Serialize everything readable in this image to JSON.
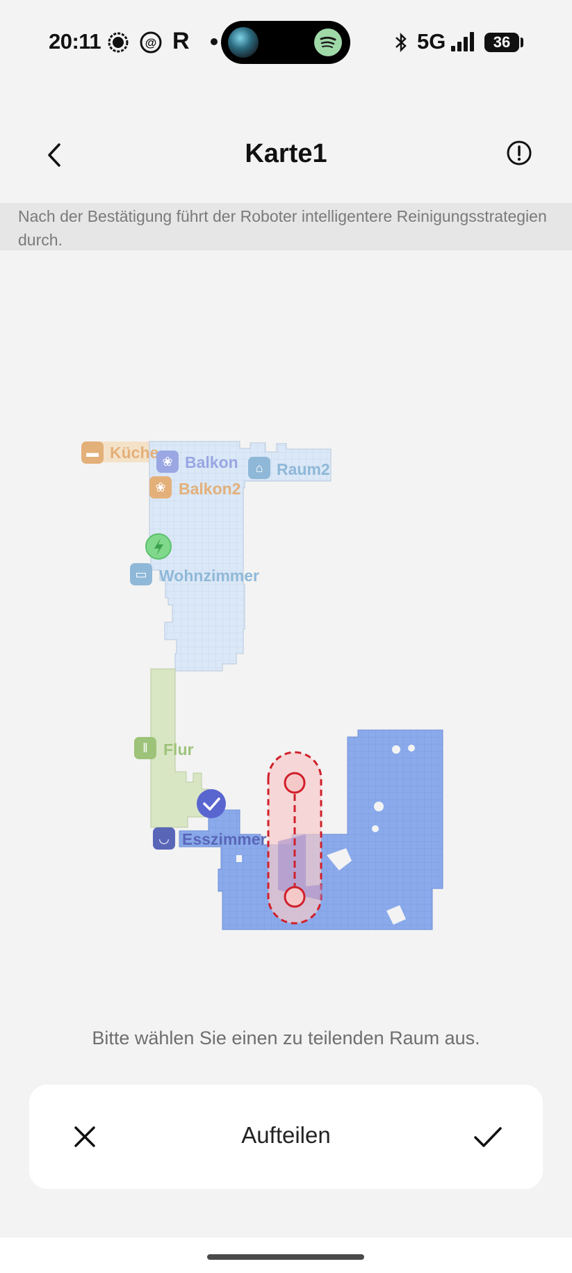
{
  "status_bar": {
    "time": "20:11",
    "network": "5G",
    "battery": "36",
    "icons": [
      "signal-messenger-icon",
      "at-icon",
      "r-app-icon",
      "dot-icon",
      "bluetooth-icon",
      "cell-signal-icon",
      "spotify-icon"
    ]
  },
  "header": {
    "title": "Karte1",
    "back_icon": "chevron-left-icon",
    "info_icon": "info-circle-icon"
  },
  "banner": {
    "text": "Nach der Bestätigung führt der Roboter intelligentere Reinigungsstrategien durch."
  },
  "map": {
    "rooms": [
      {
        "name": "Küche",
        "icon": "pot-icon",
        "color": "#e3b07a"
      },
      {
        "name": "Balkon",
        "icon": "plant-icon",
        "color": "#9aa7e3"
      },
      {
        "name": "Raum2",
        "icon": "house-icon",
        "color": "#8fb8d8"
      },
      {
        "name": "Balkon2",
        "icon": "plant-icon",
        "color": "#e3b07a"
      },
      {
        "name": "Wohnzimmer",
        "icon": "sofa-icon",
        "color": "#8fb8d8"
      },
      {
        "name": "Flur",
        "icon": "door-icon",
        "color": "#9dc37a"
      },
      {
        "name": "Esszimmer",
        "icon": "bowl-icon",
        "color": "#5966b8"
      }
    ],
    "dock_icon": "charging-dock-icon",
    "selected_icon": "check-badge-icon",
    "colors": {
      "upper_area": "#dbe8f7",
      "hall_area": "#d9e6c4",
      "selected_room": "#8aaaeb",
      "split_line": "#d0202a",
      "split_fill": "#f6c9c9"
    }
  },
  "instruction": "Bitte wählen Sie einen zu teilenden Raum aus.",
  "action_bar": {
    "cancel_icon": "close-icon",
    "label": "Aufteilen",
    "confirm_icon": "checkmark-icon"
  }
}
